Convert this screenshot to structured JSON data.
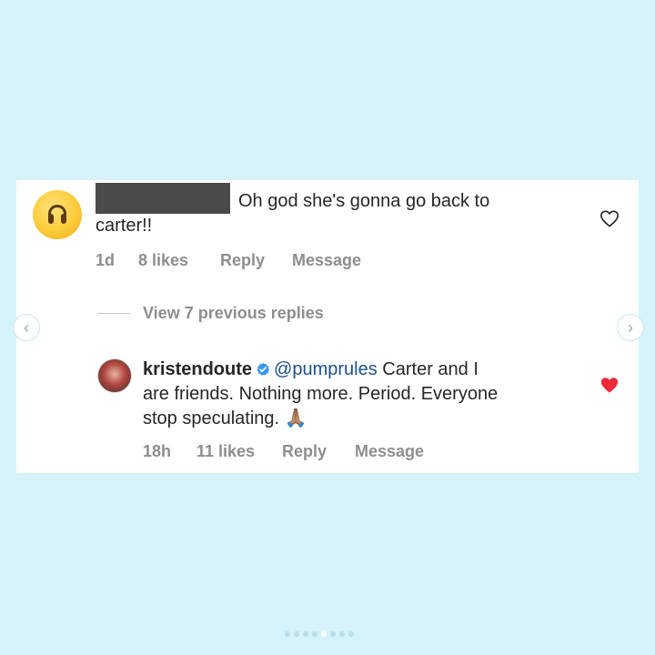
{
  "comment1": {
    "text_line1": "Oh god she's gonna go back to",
    "text_line2": "carter!!",
    "time": "1d",
    "likes": "8 likes",
    "reply_label": "Reply",
    "message_label": "Message",
    "avatar_icon": "upside-down-face-emoji"
  },
  "thread": {
    "view_previous": "View 7 previous replies"
  },
  "comment2": {
    "username": "kristendoute",
    "mention": "@pumprules",
    "text_line1_rest": "Carter and I",
    "text_line2": "are friends. Nothing more. Period. Everyone",
    "text_line3": "stop speculating.",
    "emoji": "🙏🏽",
    "time": "18h",
    "likes": "11 likes",
    "reply_label": "Reply",
    "message_label": "Message"
  },
  "colors": {
    "background": "#d6f3fb",
    "heart_red": "#ed2a3a",
    "verified_blue": "#3897f0"
  },
  "carousel": {
    "total": 8,
    "active_index": 5
  }
}
